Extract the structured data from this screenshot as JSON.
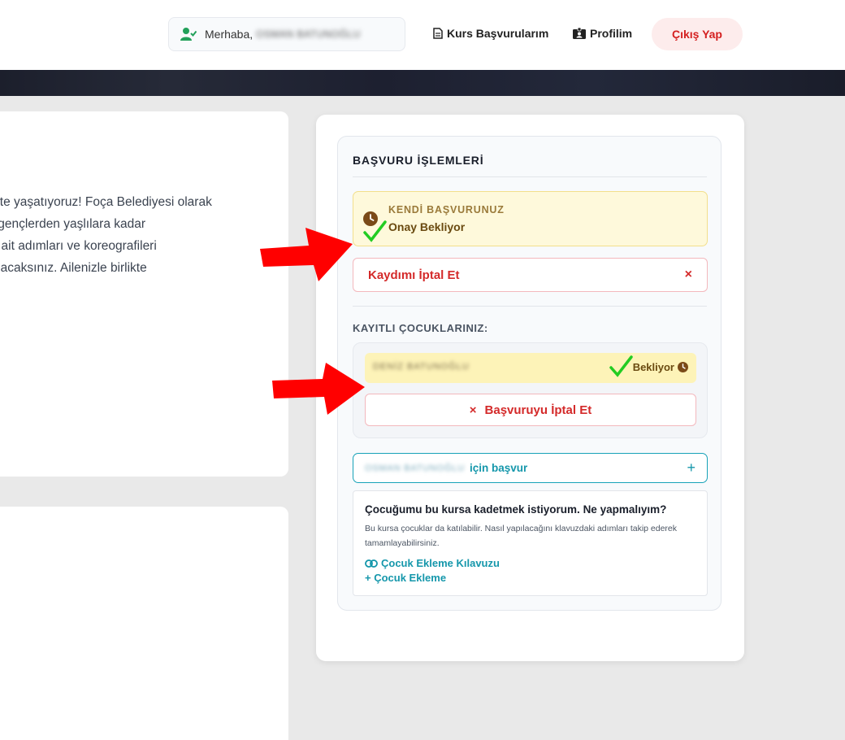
{
  "header": {
    "greeting": "Merhaba,",
    "user_name": "OSMAN BATUNOĞLU",
    "nav_courses": "Kurs Başvurularım",
    "nav_profile": "Profilim",
    "logout": "Çıkış Yap"
  },
  "left_card": {
    "lines": [
      "rlikte yaşatıyoruz! Foça Belediyesi olarak",
      "e, gençlerden yaşlılara kadar",
      "ne ait adımları ve koreografileri",
      "ı olacaksınız. Ailenizle birlikte"
    ]
  },
  "panel": {
    "title": "BAŞVURU İŞLEMLERİ",
    "own": {
      "label": "KENDİ BAŞVURUNUZ",
      "status": "Onay Bekliyor",
      "cancel": "Kaydımı İptal Et",
      "cancel_icon": "×"
    },
    "kids_title": "KAYITLI ÇOCUKLARINIZ:",
    "kid": {
      "name": "DENİZ BATUNOĞLU",
      "status": "Bekliyor",
      "cancel_icon": "×",
      "cancel": "Başvuruyu İptal Et"
    },
    "apply": {
      "name": "OSMAN BATUNOĞLU",
      "label": "için başvur",
      "plus": "+"
    },
    "help": {
      "question": "Çocuğumu bu kursa kadetmek istiyorum. Ne yapmalıyım?",
      "answer": "Bu kursa çocuklar da katılabilir. Nasıl yapılacağını klavuzdaki adımları takip ederek tamamlayabilirsiniz.",
      "guide_link": "Çocuk Ekleme Kılavuzu",
      "add_link": "+ Çocuk Ekleme"
    }
  },
  "colors": {
    "accent": "#1597ab",
    "danger": "#d42a2a",
    "pending_bg": "#fef9db",
    "annotation": "#ff0000",
    "check": "#22cc22"
  }
}
